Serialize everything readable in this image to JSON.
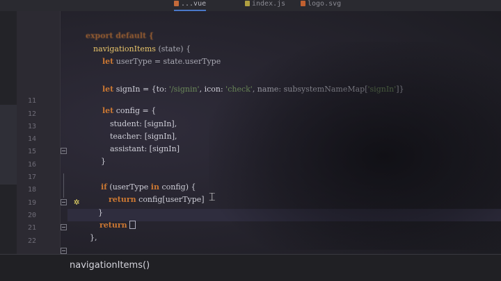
{
  "tabs": [
    {
      "label": "...vue",
      "icon": "vue-file-icon",
      "active": true
    },
    {
      "label": "index.js",
      "icon": "js-file-icon",
      "active": false
    },
    {
      "label": "logo.svg",
      "icon": "svg-file-icon",
      "active": false
    }
  ],
  "line_numbers": [
    "11",
    "12",
    "13",
    "14",
    "15",
    "16",
    "17",
    "18",
    "19",
    "20",
    "21",
    "22"
  ],
  "code": {
    "l1": [
      "export default {"
    ],
    "l2": [
      "navigationItems",
      " (state) {"
    ],
    "l3": [
      "let",
      " userType = state.userType"
    ],
    "l4": [
      "let",
      " signIn = {to: ",
      "'/signin'",
      ", icon: ",
      "'check'",
      ", name: subsystemNameMap[",
      "'signIn'",
      "]}"
    ],
    "l5": [
      "let",
      " config = {"
    ],
    "l6": [
      "student: [signIn],"
    ],
    "l7": [
      "teacher: [signIn],"
    ],
    "l8": [
      "assistant: [signIn]"
    ],
    "l9": [
      "}"
    ],
    "l10": [
      "if",
      " (userType ",
      "in",
      " config) {"
    ],
    "l11": [
      "return",
      " config[userType]"
    ],
    "l12": [
      "}"
    ],
    "l13": [
      "return",
      " "
    ],
    "l14": [
      "},"
    ]
  },
  "status_bar": {
    "breadcrumb": "navigationItems()"
  },
  "colors": {
    "keyword": "#cc7832",
    "function": "#e8c46a",
    "string": "#6a8759",
    "accent": "#4a78c8"
  }
}
